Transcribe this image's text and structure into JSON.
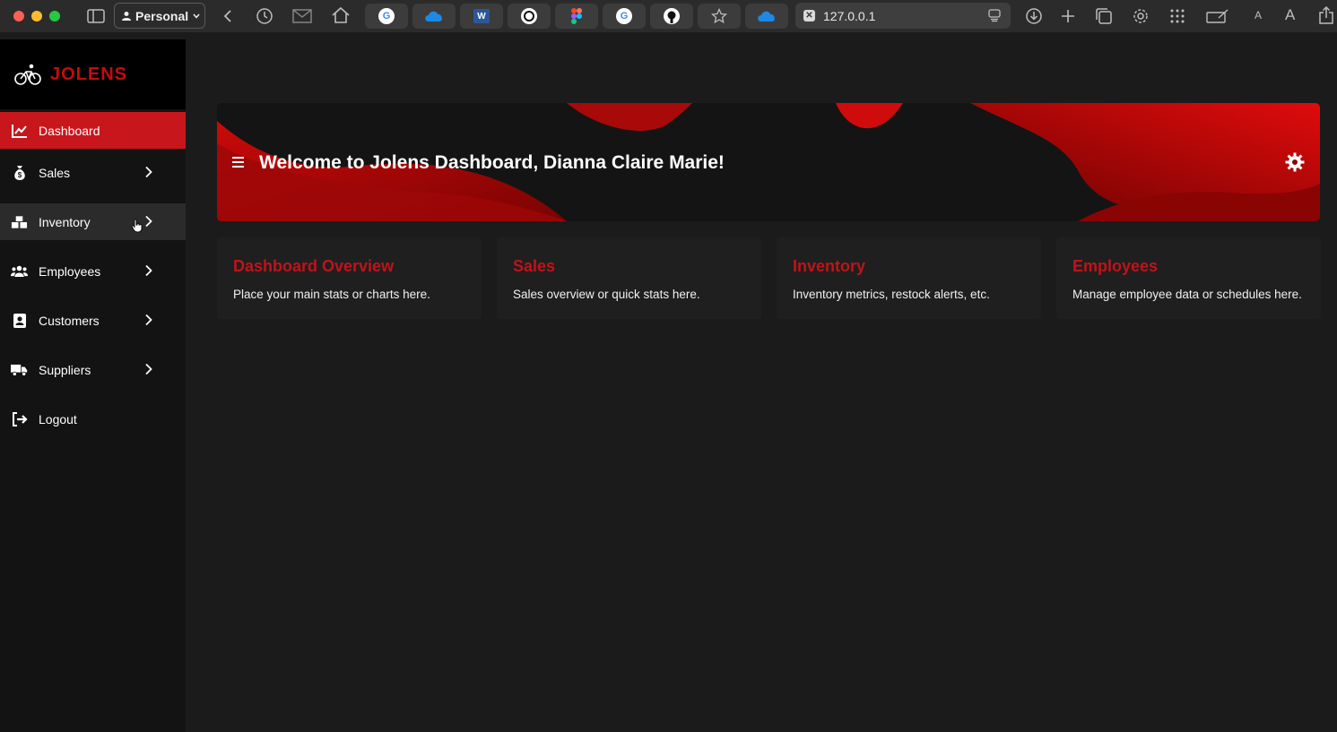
{
  "browser": {
    "profile_label": "Personal",
    "url": "127.0.0.1",
    "font_small": "A",
    "font_large": "A"
  },
  "brand": {
    "name": "JOLENS"
  },
  "sidebar": {
    "items": [
      {
        "label": "Dashboard",
        "icon": "chart-line-icon"
      },
      {
        "label": "Sales",
        "icon": "money-bag-icon"
      },
      {
        "label": "Inventory",
        "icon": "boxes-icon"
      },
      {
        "label": "Employees",
        "icon": "users-icon"
      },
      {
        "label": "Customers",
        "icon": "contact-card-icon"
      },
      {
        "label": "Suppliers",
        "icon": "truck-icon"
      },
      {
        "label": "Logout",
        "icon": "logout-icon"
      }
    ]
  },
  "banner": {
    "title": "Welcome to Jolens Dashboard, Dianna Claire Marie!"
  },
  "cards": [
    {
      "title": "Dashboard Overview",
      "desc": "Place your main stats or charts here."
    },
    {
      "title": "Sales",
      "desc": "Sales overview or quick stats here."
    },
    {
      "title": "Inventory",
      "desc": "Inventory metrics, restock alerts, etc."
    },
    {
      "title": "Employees",
      "desc": "Manage employee data or schedules here."
    }
  ],
  "colors": {
    "accent": "#c8171c",
    "sidebar_bg": "#131313",
    "page_bg": "#1b1b1b"
  }
}
